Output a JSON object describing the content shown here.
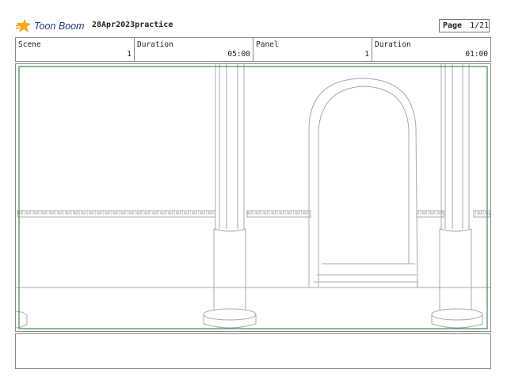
{
  "header": {
    "logo_text": "Toon Boom",
    "project_name": "28Apr2023practice",
    "page_label": "Page",
    "page_number": "1/21"
  },
  "info": {
    "scene_label": "Scene",
    "scene_value": "1",
    "scene_duration_label": "Duration",
    "scene_duration_value": "05:00",
    "panel_label": "Panel",
    "panel_value": "1",
    "panel_duration_label": "Duration",
    "panel_duration_value": "01:00"
  },
  "colors": {
    "camera_frame": "#3f8a4e",
    "logo_orange": "#f2a91f",
    "logo_text": "#1b3b7a"
  },
  "notes": {
    "text": ""
  }
}
